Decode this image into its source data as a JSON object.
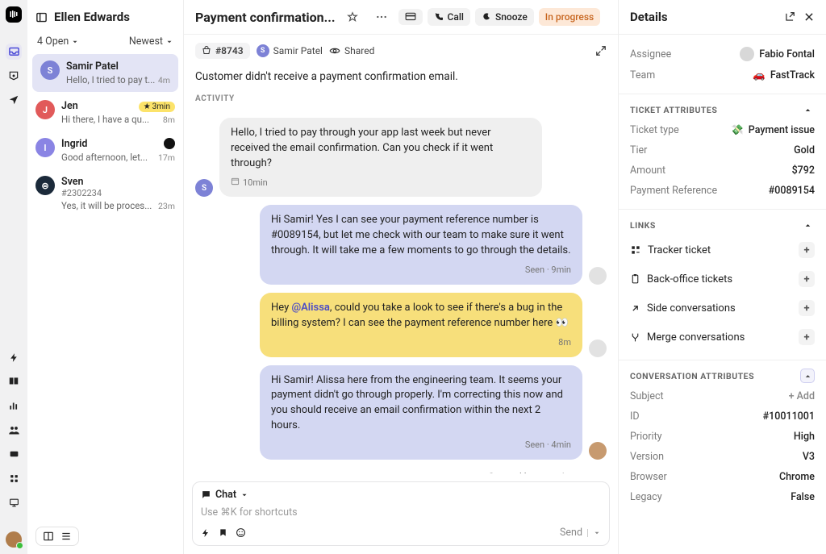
{
  "nav": {
    "queue_name": "Ellen Edwards"
  },
  "filters": {
    "open": "4 Open",
    "sort": "Newest"
  },
  "conversations": [
    {
      "name": "Samir Patel",
      "preview": "Hello, I tried to pay t...",
      "time": "4m",
      "avatar_bg": "#7d82d6",
      "initial": "S"
    },
    {
      "name": "Jen",
      "preview": "Hi there, I have a qu...",
      "time": "8m",
      "avatar_bg": "#e15a5a",
      "initial": "J",
      "badge": "3min"
    },
    {
      "name": "Ingrid",
      "preview": "Good afternoon, let...",
      "time": "17m",
      "avatar_bg": "#8a84e4",
      "initial": "I"
    },
    {
      "name": "Sven",
      "ref": "#2302234",
      "preview": "Yes, it will be proces...",
      "time": "23m",
      "avatar_bg": "#1b2a3a",
      "initial": "⊜"
    }
  ],
  "ticket": {
    "title": "Payment confirmation...",
    "id": "#8743",
    "assignee": "Samir Patel",
    "shared": "Shared",
    "call": "Call",
    "snooze": "Snooze",
    "status": "In progress",
    "description": "Customer didn't receive a payment confirmation email.",
    "activity_label": "ACTIVITY"
  },
  "messages": {
    "m0": {
      "text": "Hello, I tried to pay through your app last week but never received the email confirmation. Can you check if it went through?",
      "time": "10min"
    },
    "m1": {
      "text": "Hi Samir! Yes I can see your payment reference number is #0089154, but let me check with our team to make sure it went through. It will take me a few moments to go through the details.",
      "status": "Seen · 9min"
    },
    "m2": {
      "pre": "Hey ",
      "mention": "@Alissa",
      "post": ", could you take a look to see if there's a bug in the billing system? I can see the payment reference number here 👀",
      "status": "8m"
    },
    "m3": {
      "text": "Hi Samir! Alissa here from the engineering team. It seems your payment didn't go through properly. I'm correcting this now and you should receive an email confirmation within the next 2 hours.",
      "status": "Seen · 4min"
    },
    "created": "Created by you · Just now"
  },
  "composer": {
    "mode": "Chat",
    "placeholder": "Use ⌘K for shortcuts",
    "send": "Send"
  },
  "details": {
    "title": "Details",
    "assignee_label": "Assignee",
    "assignee_value": "Fabio Fontal",
    "team_label": "Team",
    "team_value": "FastTrack",
    "attr_title": "TICKET ATTRIBUTES",
    "type_label": "Ticket type",
    "type_value": "Payment issue",
    "tier_label": "Tier",
    "tier_value": "Gold",
    "amount_label": "Amount",
    "amount_value": "$792",
    "ref_label": "Payment Reference",
    "ref_value": "#0089154",
    "links_title": "LINKS",
    "link_tracker": "Tracker ticket",
    "link_backoffice": "Back-office tickets",
    "link_side": "Side conversations",
    "link_merge": "Merge conversations",
    "conv_title": "CONVERSATION ATTRIBUTES",
    "subject_label": "Subject",
    "subject_value": "+ Add",
    "id_label": "ID",
    "id_value": "#10011001",
    "priority_label": "Priority",
    "priority_value": "High",
    "version_label": "Version",
    "version_value": "V3",
    "browser_label": "Browser",
    "browser_value": "Chrome",
    "legacy_label": "Legacy",
    "legacy_value": "False"
  }
}
